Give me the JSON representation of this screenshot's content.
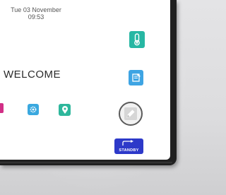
{
  "header": {
    "date": "Tue 03 November",
    "time": "09:53"
  },
  "main": {
    "welcome": "WELCOME"
  },
  "controls": {
    "standby_label": "STANDBY"
  },
  "colors": {
    "thermostat_tile": "#27b7a3",
    "document_tile": "#3ea4e3",
    "pink_tile": "#d12f86",
    "settings_tile": "#3aa8df",
    "location_tile": "#2eb79c",
    "standby_button": "#2d39c9"
  },
  "icons": {
    "thermostat": "thermometer-icon",
    "document": "document-edit-icon",
    "settings": "gear-icon",
    "location": "map-pin-icon",
    "edit": "pen-icon",
    "standby": "return-arrow-icon"
  }
}
